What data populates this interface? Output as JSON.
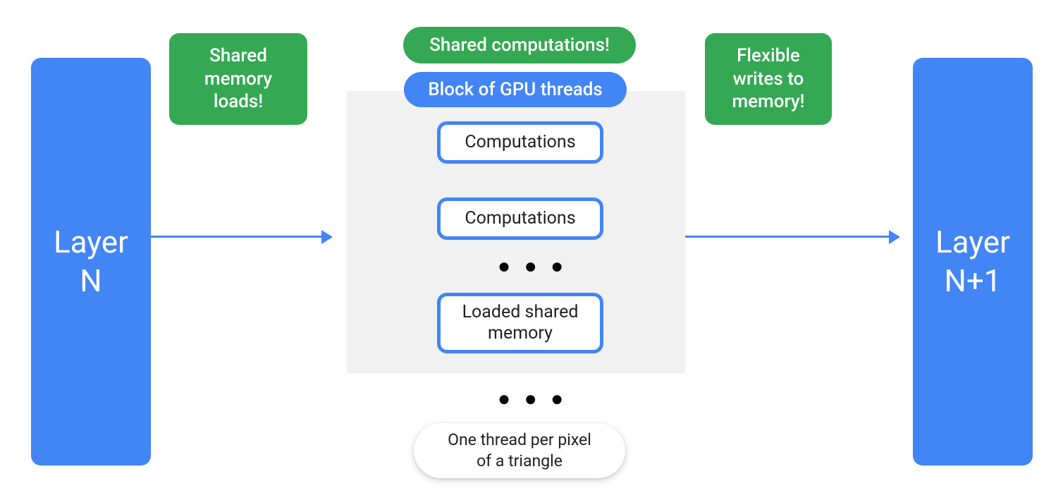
{
  "layers": {
    "left": "Layer\nN",
    "right": "Layer\nN+1"
  },
  "callouts": {
    "shared_loads": "Shared\nmemory\nloads!",
    "shared_comp": "Shared computations!",
    "flex_writes": "Flexible\nwrites to\nmemory!"
  },
  "block": {
    "title": "Block of GPU threads",
    "items": [
      "Computations",
      "Computations",
      "Loaded shared memory"
    ]
  },
  "caption": "One thread per pixel\nof a triangle",
  "dots": "● ● ●"
}
